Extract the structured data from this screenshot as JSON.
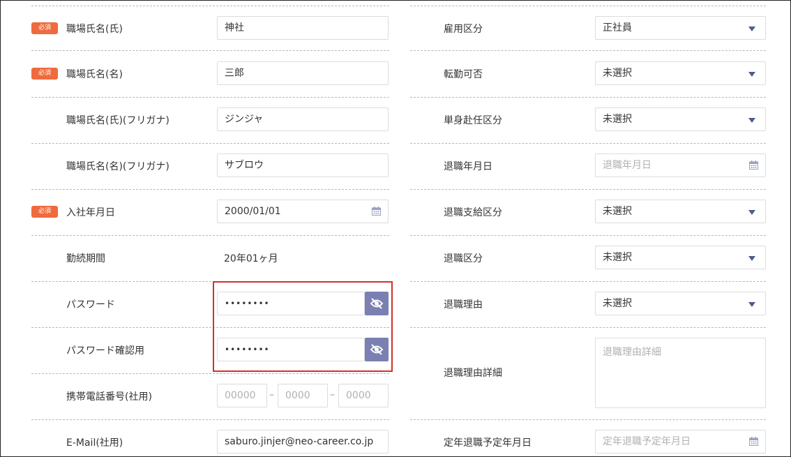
{
  "required_badge": "必須",
  "left": {
    "last_name": {
      "label": "職場氏名(氏)",
      "value": "神社"
    },
    "first_name": {
      "label": "職場氏名(名)",
      "value": "三郎"
    },
    "last_name_kana": {
      "label": "職場氏名(氏)(フリガナ)",
      "value": "ジンジャ"
    },
    "first_name_kana": {
      "label": "職場氏名(名)(フリガナ)",
      "value": "サブロウ"
    },
    "hire_date": {
      "label": "入社年月日",
      "value": "2000/01/01"
    },
    "tenure": {
      "label": "勤続期間",
      "value": "20年01ヶ月"
    },
    "password": {
      "label": "パスワード",
      "value": "••••••••"
    },
    "password_confirm": {
      "label": "パスワード確認用",
      "value": "••••••••"
    },
    "mobile": {
      "label": "携帯電話番号(社用)",
      "p1": "00000",
      "p2": "0000",
      "p3": "0000",
      "sep": "–"
    },
    "email": {
      "label": "E-Mail(社用)",
      "value": "saburo.jinjer@neo-career.co.jp"
    }
  },
  "right": {
    "employment_type": {
      "label": "雇用区分",
      "value": "正社員"
    },
    "transfer": {
      "label": "転勤可否",
      "value": "未選択"
    },
    "single_assignment": {
      "label": "単身赴任区分",
      "value": "未選択"
    },
    "retire_date": {
      "label": "退職年月日",
      "placeholder": "退職年月日"
    },
    "severance": {
      "label": "退職支給区分",
      "value": "未選択"
    },
    "retire_type": {
      "label": "退職区分",
      "value": "未選択"
    },
    "retire_reason": {
      "label": "退職理由",
      "value": "未選択"
    },
    "retire_detail": {
      "label": "退職理由詳細",
      "placeholder": "退職理由詳細"
    },
    "mandatory_retire": {
      "label": "定年退職予定年月日",
      "placeholder": "定年退職予定年月日"
    }
  },
  "colors": {
    "badge": "#ef6b3d",
    "caret": "#4b5c8c",
    "eye_button": "#7a80b2",
    "highlight": "#d2302c"
  },
  "icons": {
    "select": "chevron-down-icon",
    "date": "calendar-icon",
    "password_toggle": "eye-slash-icon"
  }
}
